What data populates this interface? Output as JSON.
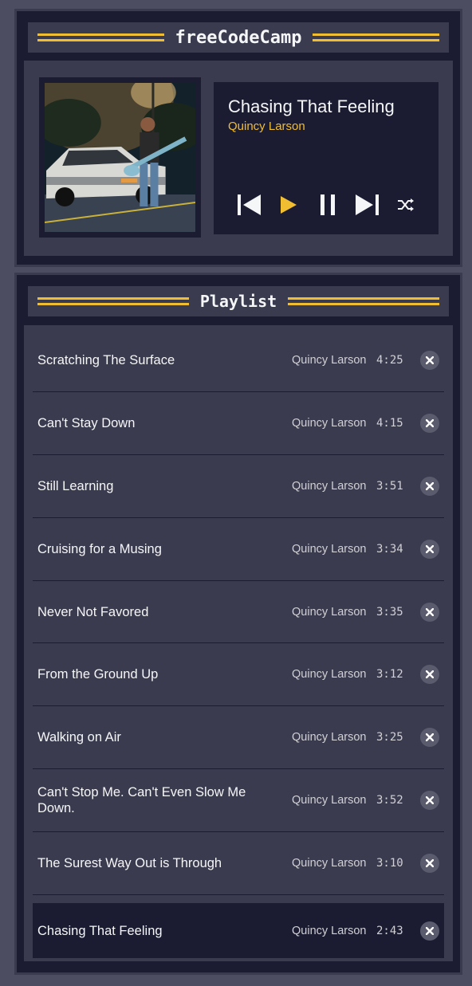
{
  "header": {
    "title": "freeCodeCamp"
  },
  "player": {
    "current_title": "Chasing That Feeling",
    "current_artist": "Quincy Larson",
    "controls": [
      "previous-icon",
      "play-icon",
      "pause-icon",
      "next-icon",
      "shuffle-icon"
    ],
    "accent_color": "#f1be32"
  },
  "playlist": {
    "title": "Playlist",
    "songs": [
      {
        "title": "Scratching The Surface",
        "artist": "Quincy Larson",
        "duration": "4:25"
      },
      {
        "title": "Can't Stay Down",
        "artist": "Quincy Larson",
        "duration": "4:15"
      },
      {
        "title": "Still Learning",
        "artist": "Quincy Larson",
        "duration": "3:51"
      },
      {
        "title": "Cruising for a Musing",
        "artist": "Quincy Larson",
        "duration": "3:34"
      },
      {
        "title": "Never Not Favored",
        "artist": "Quincy Larson",
        "duration": "3:35"
      },
      {
        "title": "From the Ground Up",
        "artist": "Quincy Larson",
        "duration": "3:12"
      },
      {
        "title": "Walking on Air",
        "artist": "Quincy Larson",
        "duration": "3:25"
      },
      {
        "title": "Can't Stop Me. Can't Even Slow Me Down.",
        "artist": "Quincy Larson",
        "duration": "3:52"
      },
      {
        "title": "The Surest Way Out is Through",
        "artist": "Quincy Larson",
        "duration": "3:10"
      },
      {
        "title": "Chasing That Feeling",
        "artist": "Quincy Larson",
        "duration": "2:43"
      }
    ]
  }
}
